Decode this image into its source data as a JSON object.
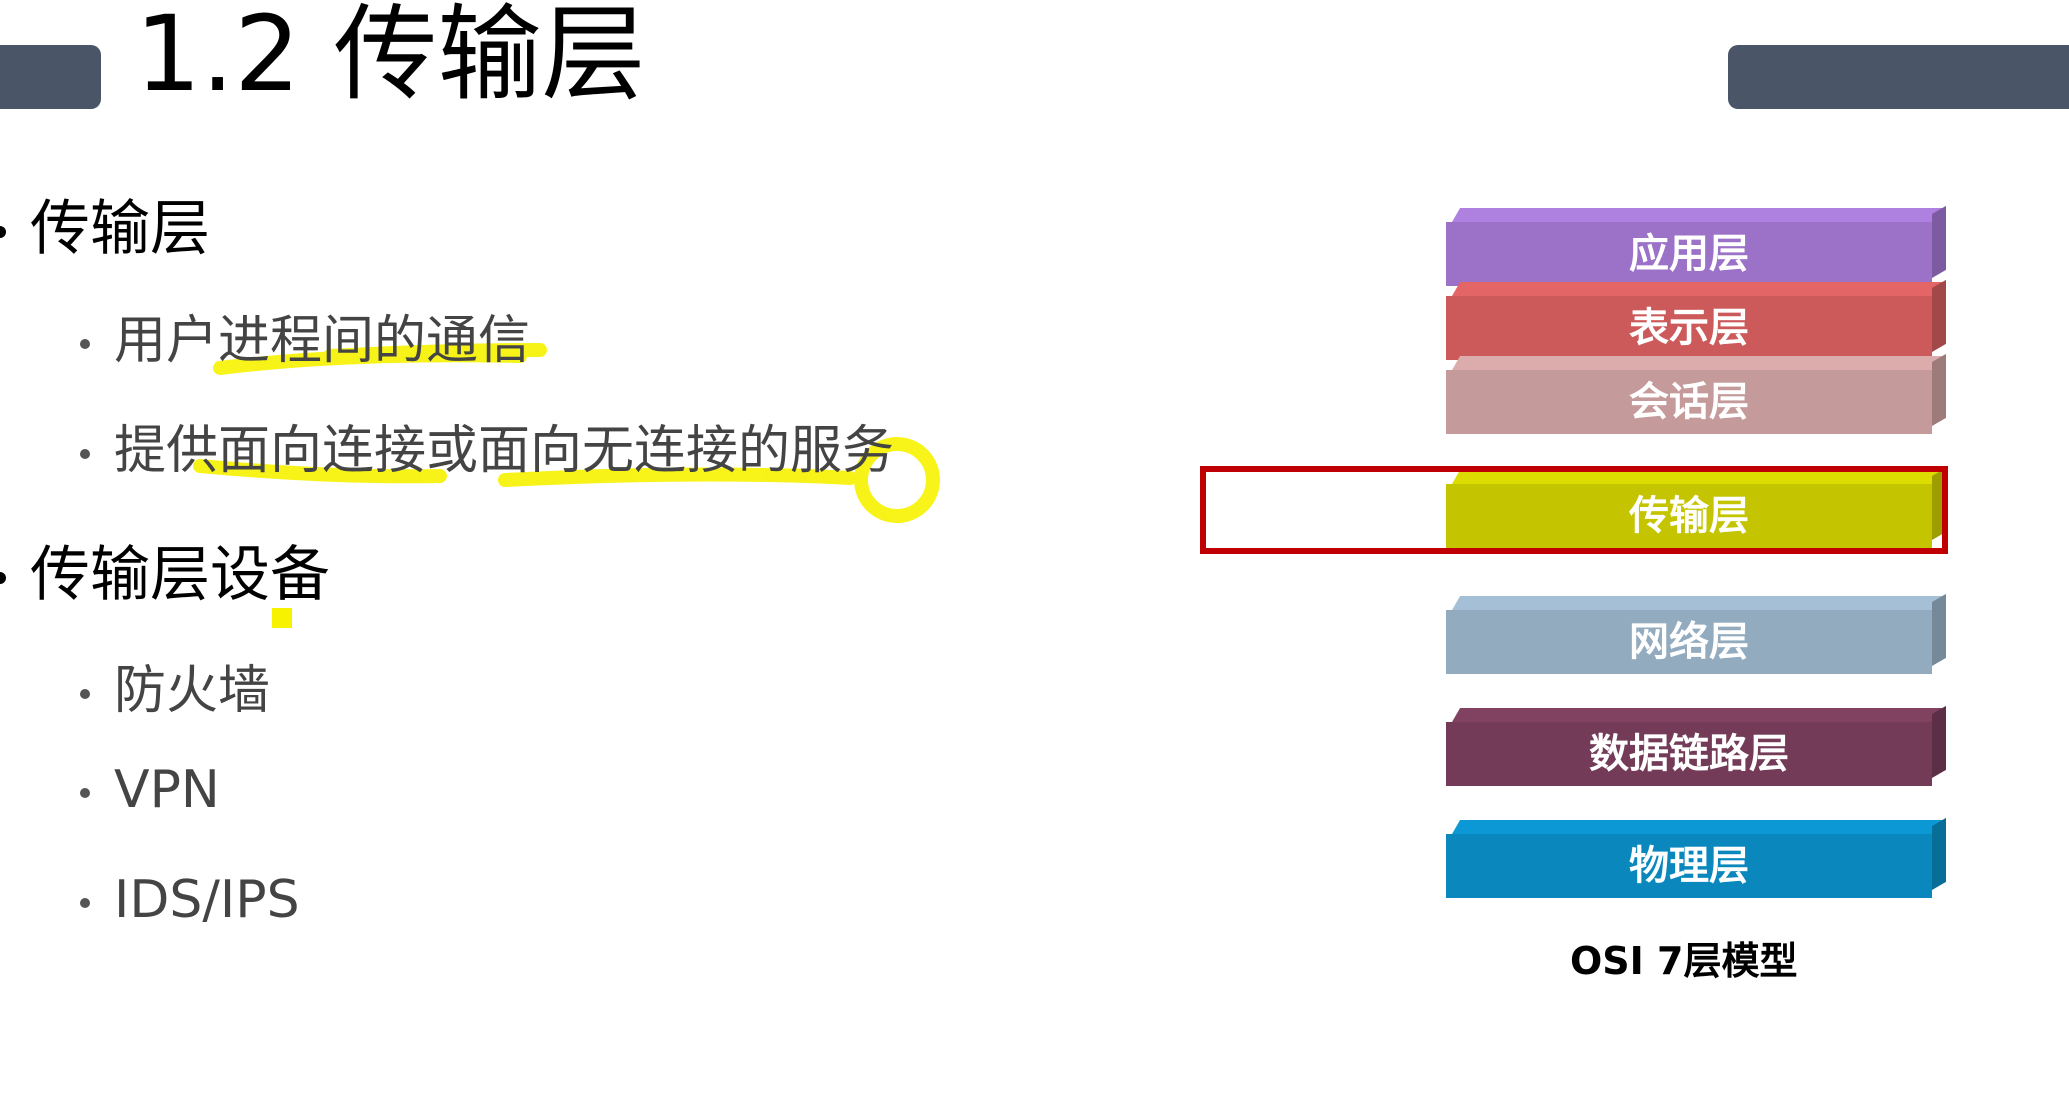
{
  "header": {
    "title": "1.2 传输层"
  },
  "content": {
    "section1": {
      "heading": "传输层",
      "items": [
        "用户进程间的通信",
        "提供面向连接或面向无连接的服务"
      ]
    },
    "section2": {
      "heading": "传输层设备",
      "items": [
        "防火墙",
        "VPN",
        "IDS/IPS"
      ]
    }
  },
  "osi": {
    "caption": "OSI 7层模型",
    "highlight_color": "#c00000",
    "layers": [
      {
        "label": "应用层",
        "color": "#9b72c8"
      },
      {
        "label": "表示层",
        "color": "#cc5a5a"
      },
      {
        "label": "会话层",
        "color": "#c49a9a"
      },
      {
        "label": "传输层",
        "color": "#c4c400"
      },
      {
        "label": "网络层",
        "color": "#93abbf"
      },
      {
        "label": "数据链路层",
        "color": "#733b57"
      },
      {
        "label": "物理层",
        "color": "#0a88bd"
      }
    ]
  },
  "annotation": {
    "highlighter_color": "#f7f200"
  }
}
